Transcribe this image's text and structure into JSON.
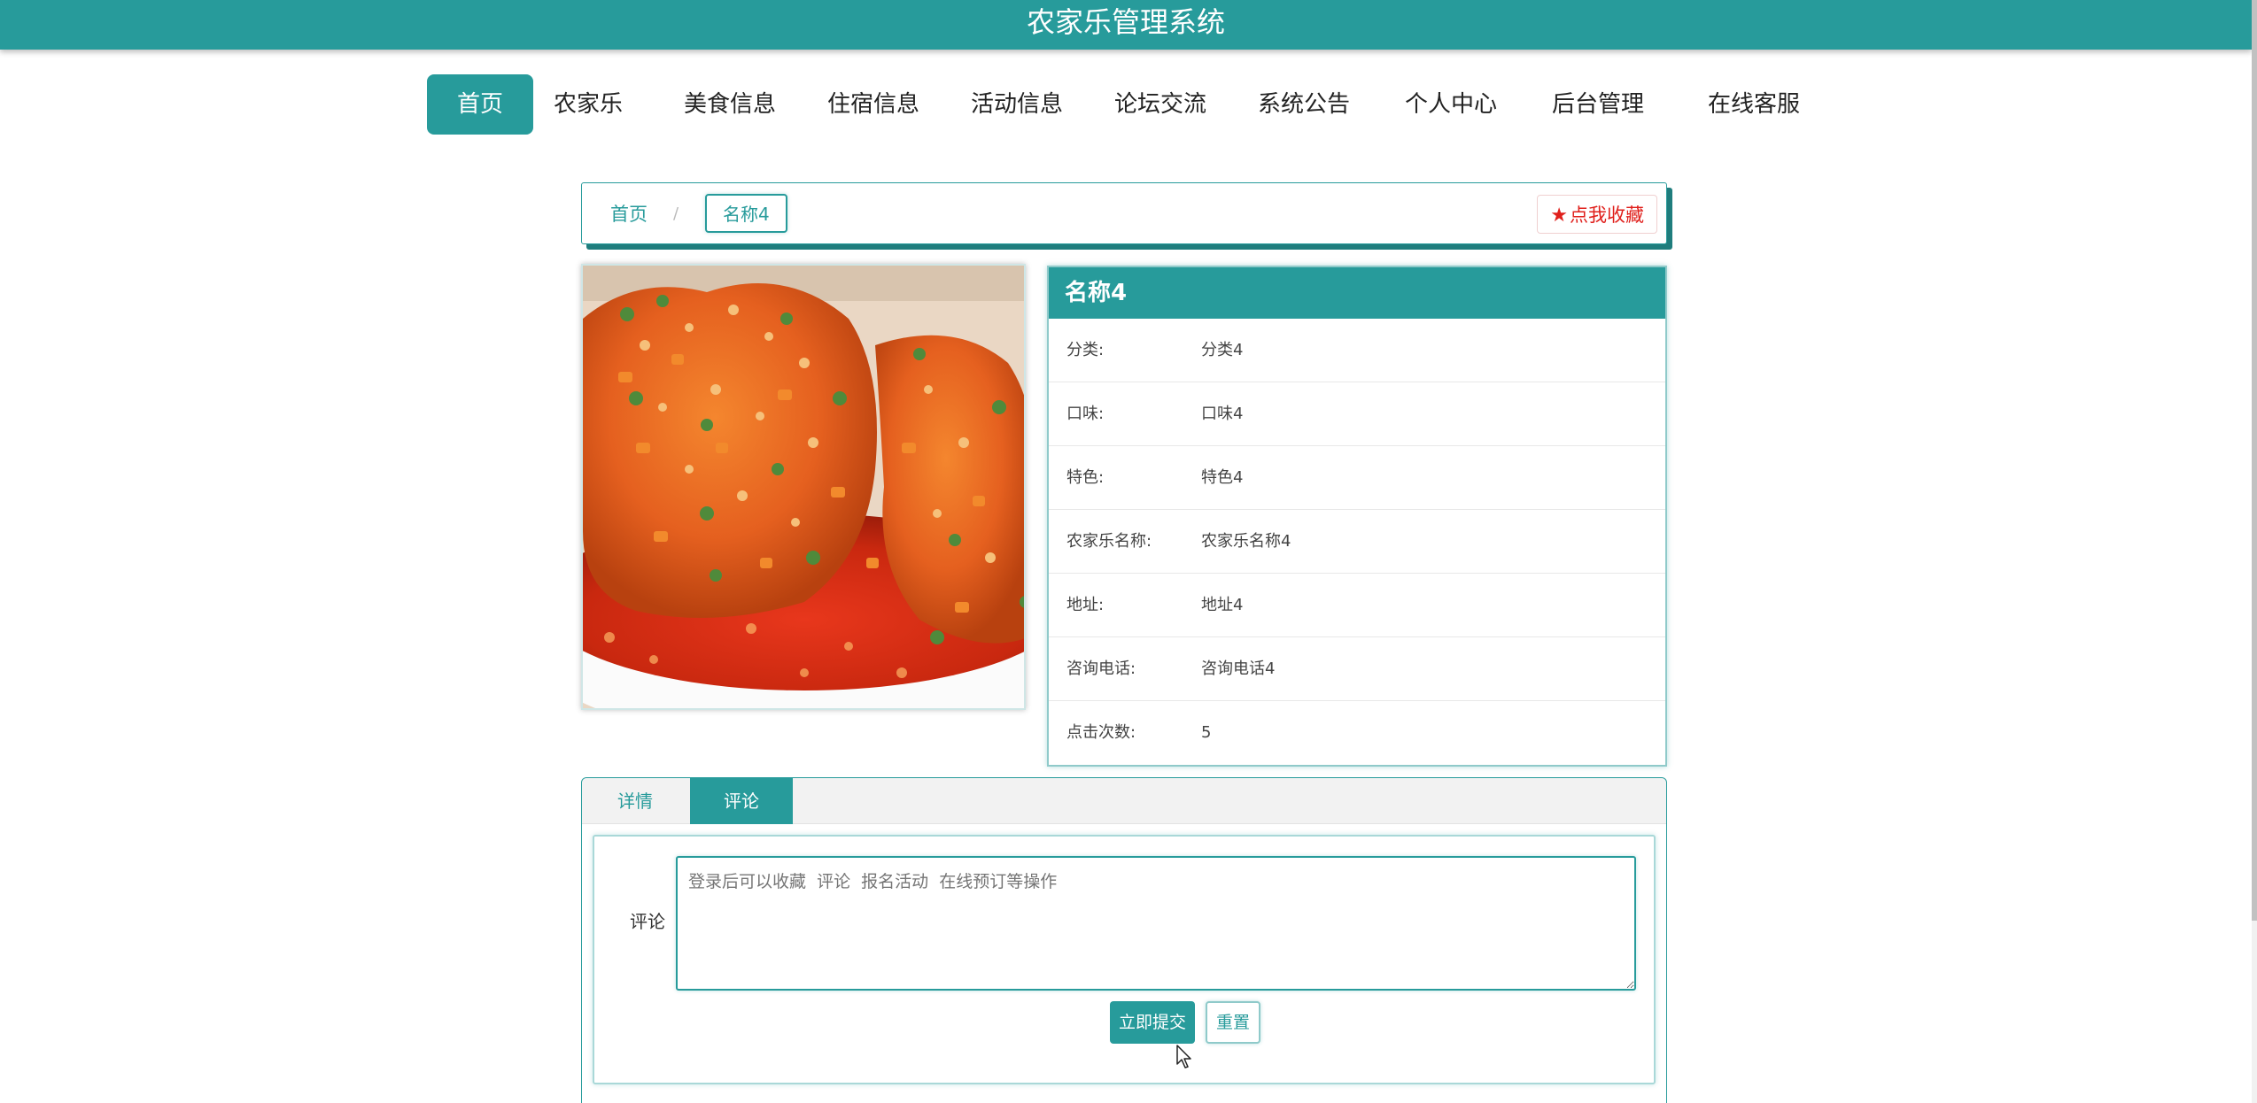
{
  "app": {
    "title": "农家乐管理系统"
  },
  "nav": {
    "items": [
      {
        "label": "首页",
        "active": true
      },
      {
        "label": "农家乐"
      },
      {
        "label": "美食信息"
      },
      {
        "label": "住宿信息"
      },
      {
        "label": "活动信息"
      },
      {
        "label": "论坛交流"
      },
      {
        "label": "系统公告"
      },
      {
        "label": "个人中心"
      },
      {
        "label": "后台管理"
      },
      {
        "label": "在线客服"
      }
    ]
  },
  "breadcrumb": {
    "home": "首页",
    "separator": "/",
    "current": "名称4"
  },
  "favorite": {
    "label": "点我收藏",
    "icon": "star-icon"
  },
  "detail": {
    "title": "名称4",
    "rows": [
      {
        "label": "分类:",
        "value": "分类4"
      },
      {
        "label": "口味:",
        "value": "口味4"
      },
      {
        "label": "特色:",
        "value": "特色4"
      },
      {
        "label": "农家乐名称:",
        "value": "农家乐名称4"
      },
      {
        "label": "地址:",
        "value": "地址4"
      },
      {
        "label": "咨询电话:",
        "value": "咨询电话4"
      },
      {
        "label": "点击次数:",
        "value": "5"
      }
    ]
  },
  "tabs": {
    "items": [
      {
        "label": "详情"
      },
      {
        "label": "评论",
        "active": true
      }
    ]
  },
  "comment": {
    "label": "评论",
    "placeholder": "登录后可以收藏  评论  报名活动  在线预订等操作",
    "submit": "立即提交",
    "reset": "重置"
  },
  "colors": {
    "accent": "#279b9b",
    "favorite": "#e0201c"
  }
}
